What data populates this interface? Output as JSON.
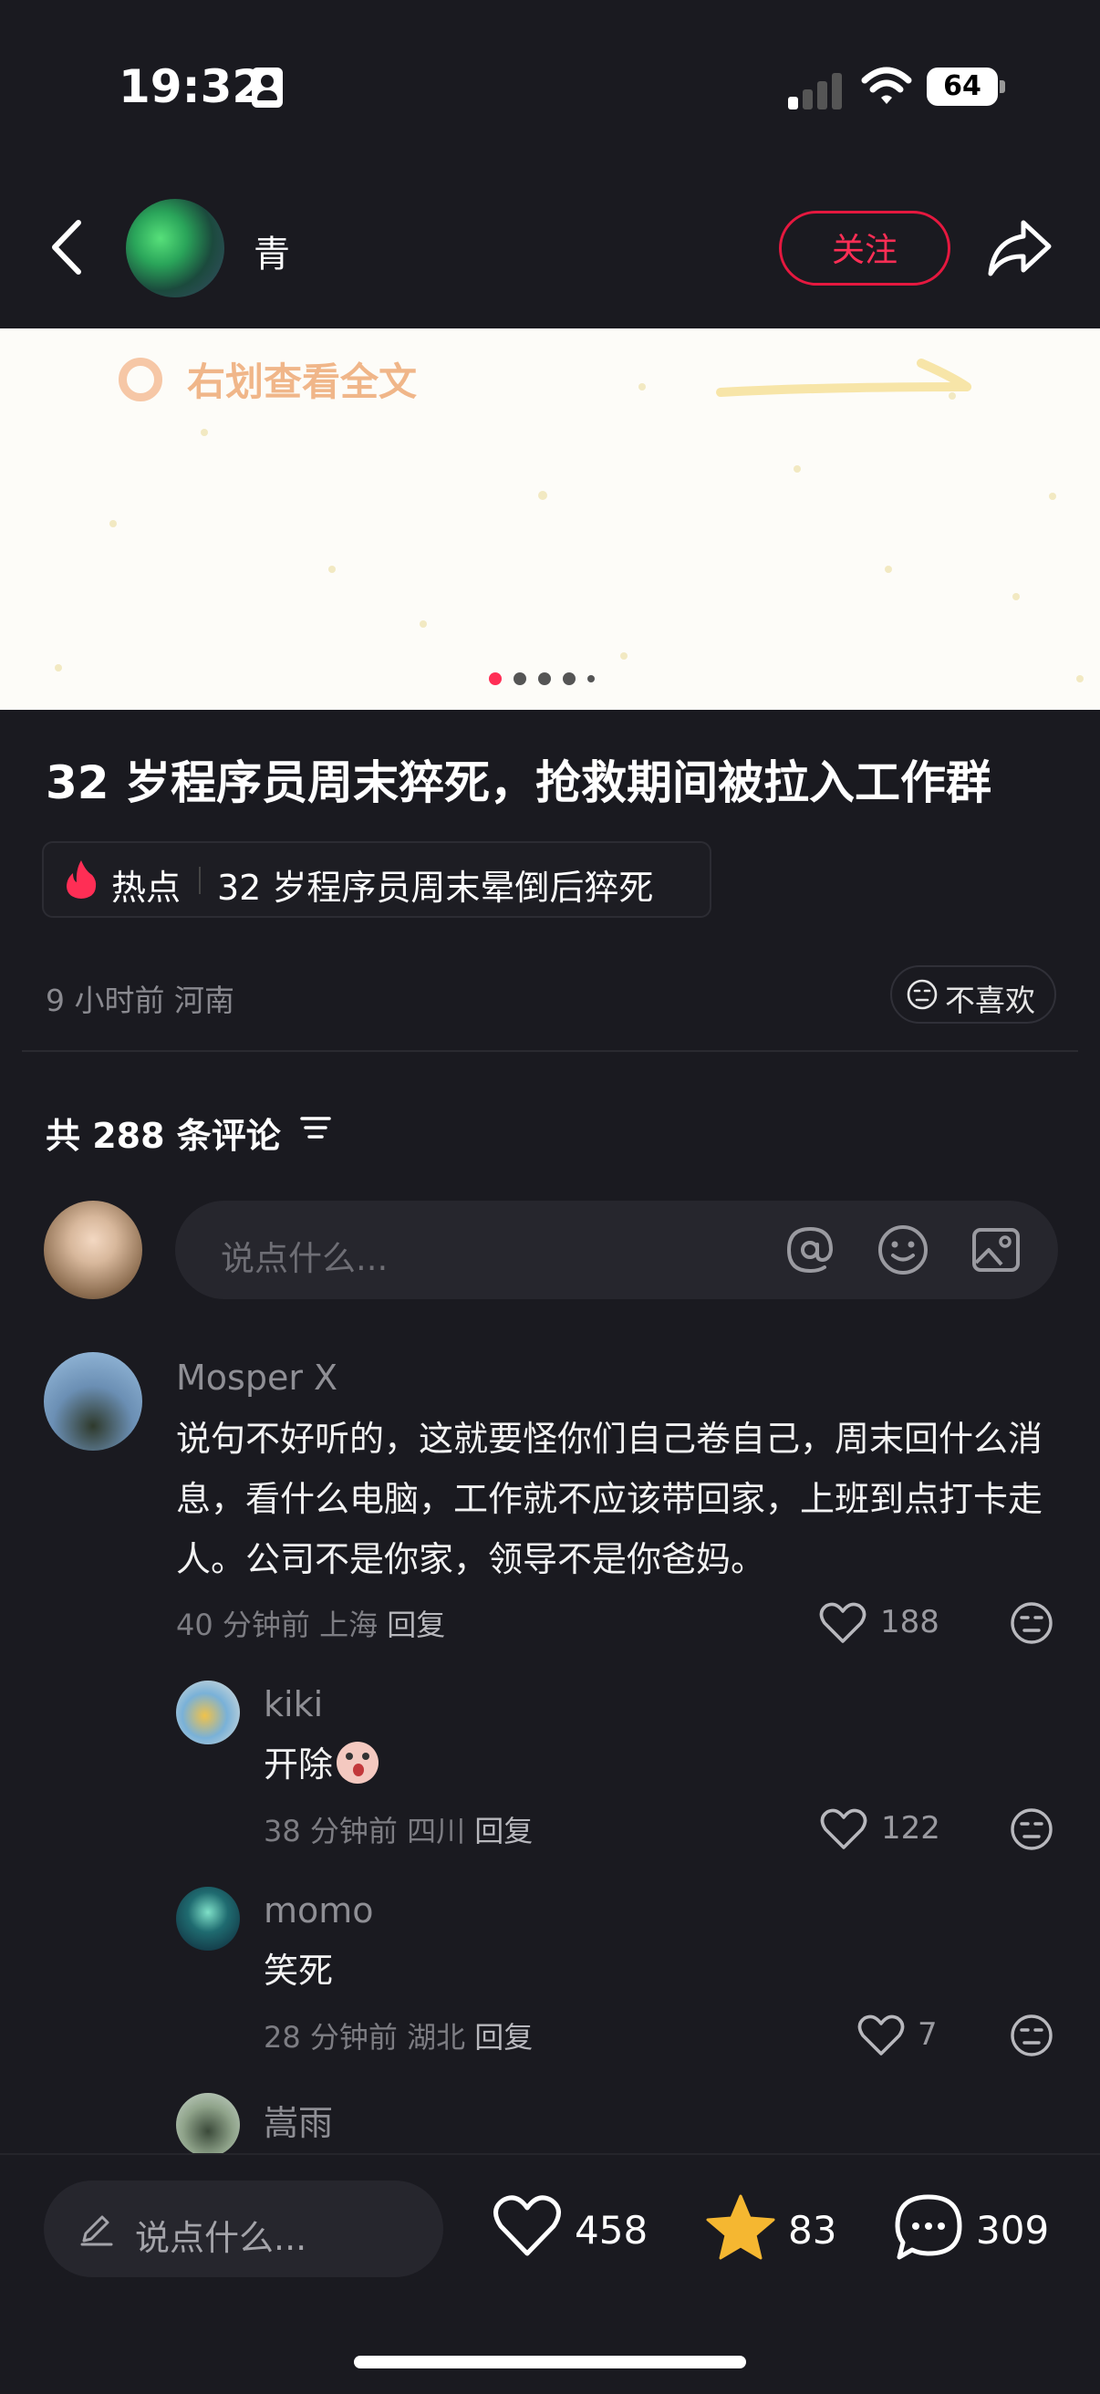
{
  "status_bar": {
    "time": "19:32",
    "battery": "64"
  },
  "header": {
    "author": "青",
    "follow_label": "关注"
  },
  "hero": {
    "hint": "右划查看全文",
    "pages": 5,
    "active_page": 1
  },
  "post": {
    "title": "32 岁程序员周末猝死，抢救期间被拉入工作群",
    "hot_label": "热点",
    "hot_topic": "32 岁程序员周末晕倒后猝死",
    "meta": "9 小时前 河南",
    "dislike_label": "不喜欢"
  },
  "comments_header": {
    "count_text": "共 288 条评论",
    "input_placeholder": "说点什么..."
  },
  "comments": [
    {
      "name": "Mosper X",
      "text": "说句不好听的，这就要怪你们自己卷自己，周末回什么消息，看什么电脑，工作就不应该带回家，上班到点打卡走人。公司不是你家，领导不是你爸妈。",
      "time": "40 分钟前 上海",
      "reply": "回复",
      "likes": "188"
    },
    {
      "name": "kiki",
      "text": "开除",
      "time": "38 分钟前 四川",
      "reply": "回复",
      "likes": "122"
    },
    {
      "name": "momo",
      "text": "笑死",
      "time": "28 分钟前 湖北",
      "reply": "回复",
      "likes": "7"
    },
    {
      "name": "嵩雨"
    }
  ],
  "bottom_bar": {
    "input_placeholder": "说点什么...",
    "likes": "458",
    "favorites": "83",
    "comments": "309"
  },
  "colors": {
    "accent": "#ff2e55",
    "background": "#1a1a20",
    "star": "#f5b731"
  }
}
